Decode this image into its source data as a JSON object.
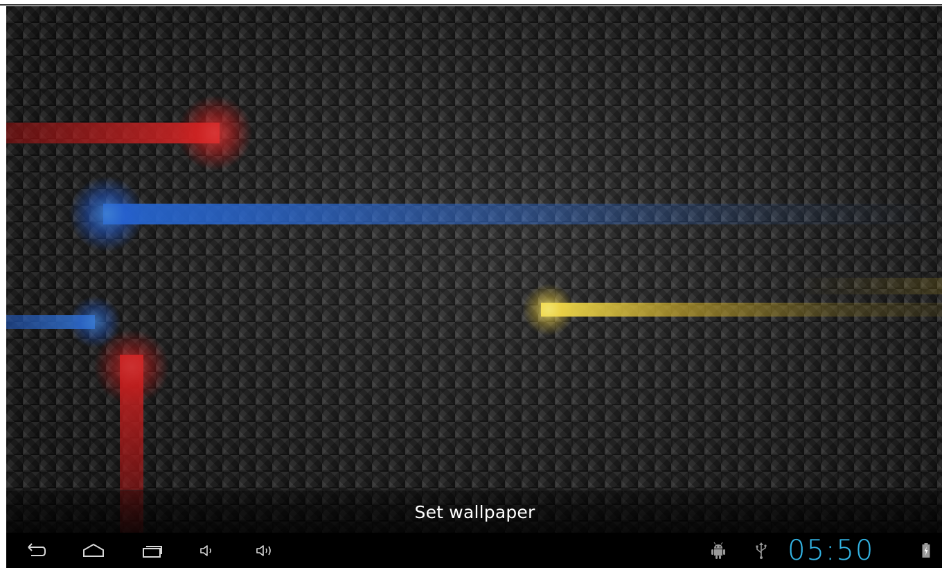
{
  "wallpaper": {
    "name": "live-wallpaper-preview",
    "action_label": "Set wallpaper",
    "streak_colors": {
      "red": "#ff2828",
      "blue": "#2f7dff",
      "yellow": "#ffe650"
    }
  },
  "navbar": {
    "buttons": [
      {
        "name": "back-button",
        "icon": "back-icon"
      },
      {
        "name": "home-button",
        "icon": "home-icon"
      },
      {
        "name": "recent-apps-button",
        "icon": "recent-apps-icon"
      },
      {
        "name": "volume-down-button",
        "icon": "volume-down-icon"
      },
      {
        "name": "volume-up-button",
        "icon": "volume-up-icon"
      }
    ]
  },
  "status": {
    "icons": [
      "android-debug-icon",
      "usb-icon",
      "battery-charging-icon"
    ],
    "time": "05:50",
    "accent_color": "#33b5e5"
  }
}
